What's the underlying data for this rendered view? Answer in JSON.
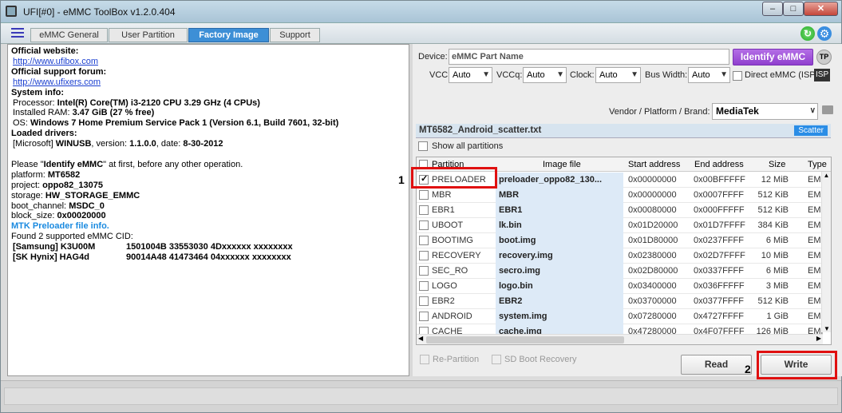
{
  "window": {
    "title": "UFI[#0] - eMMC ToolBox v1.2.0.404"
  },
  "tabs": [
    "eMMC General",
    "User Partition",
    "Factory Image",
    "Support"
  ],
  "active_tab_index": 2,
  "log": {
    "official_website_label": "Official website:",
    "official_website_url": "http://www.ufibox.com",
    "support_forum_label": "Official support forum:",
    "support_forum_url": "http://www.ufixers.com",
    "system_info_label": "System info:",
    "processor_label": "Processor:",
    "processor_value": "Intel(R) Core(TM) i3-2120 CPU 3.29 GHz (4 CPUs)",
    "ram_label": "Installed RAM:",
    "ram_value": "3.47 GiB (27 % free)",
    "os_label": "OS:",
    "os_value": "Windows 7 Home Premium Service Pack 1 (Version 6.1, Build 7601, 32-bit)",
    "drivers_label": "Loaded drivers:",
    "driver_vendor": "[Microsoft]",
    "driver_name": "WINUSB",
    "driver_version_label": ", version:",
    "driver_version": "1.1.0.0",
    "driver_date_label": ", date:",
    "driver_date": "8-30-2012",
    "please_pre": "Please \"",
    "please_bold": "Identify eMMC",
    "please_post": "\" at first, before any other operation.",
    "platform_label": "platform:",
    "platform_value": "MT6582",
    "project_label": "project:",
    "project_value": "oppo82_13075",
    "storage_label": "storage:",
    "storage_value": "HW_STORAGE_EMMC",
    "boot_channel_label": "boot_channel:",
    "boot_channel_value": "MSDC_0",
    "block_size_label": "block_size:",
    "block_size_value": "0x00020000",
    "preloader_info": "MTK Preloader file info.",
    "cid_found": "Found 2 supported eMMC CID:",
    "cids": [
      {
        "name": "[Samsung] K3U00M",
        "value": "1501004B 33553030 4Dxxxxxx xxxxxxxx"
      },
      {
        "name": "[SK Hynix] HAG4d",
        "value": "90014A48 41473464 04xxxxxx xxxxxxxx"
      }
    ]
  },
  "device": {
    "label": "Device:",
    "placeholder": "eMMC Part Name",
    "identify_button": "Identify eMMC",
    "tp_label": "TP",
    "vcc_label": "VCC:",
    "vcc_value": "Auto",
    "vccq_label": "VCCq:",
    "vccq_value": "Auto",
    "clock_label": "Clock:",
    "clock_value": "Auto",
    "bus_label": "Bus Width:",
    "bus_value": "Auto",
    "direct_label": "Direct eMMC (ISP)",
    "isp_tag": "ISP"
  },
  "vendor": {
    "label": "Vendor / Platform / Brand:",
    "value": "MediaTek"
  },
  "scatter": {
    "filename": "MT6582_Android_scatter.txt",
    "badge": "Scatter"
  },
  "show_all_label": "Show all partitions",
  "columns": [
    "Partition",
    "Image file",
    "Start address",
    "End address",
    "Size",
    "Type"
  ],
  "rows": [
    {
      "checked": true,
      "partition": "PRELOADER",
      "image": "preloader_oppo82_130...",
      "start": "0x00000000",
      "end": "0x00BFFFFF",
      "size": "12 MiB",
      "type": "EMM"
    },
    {
      "checked": false,
      "partition": "MBR",
      "image": "MBR",
      "start": "0x00000000",
      "end": "0x0007FFFF",
      "size": "512 KiB",
      "type": "EMM"
    },
    {
      "checked": false,
      "partition": "EBR1",
      "image": "EBR1",
      "start": "0x00080000",
      "end": "0x000FFFFF",
      "size": "512 KiB",
      "type": "EMM"
    },
    {
      "checked": false,
      "partition": "UBOOT",
      "image": "lk.bin",
      "start": "0x01D20000",
      "end": "0x01D7FFFF",
      "size": "384 KiB",
      "type": "EMM"
    },
    {
      "checked": false,
      "partition": "BOOTIMG",
      "image": "boot.img",
      "start": "0x01D80000",
      "end": "0x0237FFFF",
      "size": "6 MiB",
      "type": "EMM"
    },
    {
      "checked": false,
      "partition": "RECOVERY",
      "image": "recovery.img",
      "start": "0x02380000",
      "end": "0x02D7FFFF",
      "size": "10 MiB",
      "type": "EMM"
    },
    {
      "checked": false,
      "partition": "SEC_RO",
      "image": "secro.img",
      "start": "0x02D80000",
      "end": "0x0337FFFF",
      "size": "6 MiB",
      "type": "EMM"
    },
    {
      "checked": false,
      "partition": "LOGO",
      "image": "logo.bin",
      "start": "0x03400000",
      "end": "0x036FFFFF",
      "size": "3 MiB",
      "type": "EMM"
    },
    {
      "checked": false,
      "partition": "EBR2",
      "image": "EBR2",
      "start": "0x03700000",
      "end": "0x0377FFFF",
      "size": "512 KiB",
      "type": "EMM"
    },
    {
      "checked": false,
      "partition": "ANDROID",
      "image": "system.img",
      "start": "0x07280000",
      "end": "0x4727FFFF",
      "size": "1 GiB",
      "type": "EMM"
    },
    {
      "checked": false,
      "partition": "CACHE",
      "image": "cache.img",
      "start": "0x47280000",
      "end": "0x4F07FFFF",
      "size": "126 MiB",
      "type": "EMM"
    }
  ],
  "options": {
    "repartition": "Re-Partition",
    "sd_boot": "SD Boot Recovery"
  },
  "actions": {
    "read": "Read",
    "write": "Write"
  },
  "annotations": [
    "1",
    "2"
  ],
  "colors": {
    "accent": "#3d8fd6",
    "purple": "#9b4fd8",
    "highlight": "#e01010",
    "image_col": "#ddeaf7"
  }
}
